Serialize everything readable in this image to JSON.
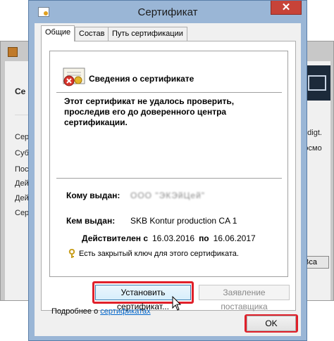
{
  "dialog": {
    "title": "Сертификат",
    "close_glyph": "✕",
    "tabs": [
      {
        "label": "Общие",
        "active": true
      },
      {
        "label": "Состав",
        "active": false
      },
      {
        "label": "Путь сертификации",
        "active": false
      }
    ]
  },
  "general": {
    "heading": "Сведения о сертификате",
    "warning": "Этот сертификат не удалось проверить, проследив его до доверенного центра сертификации.",
    "issued_to_label": "Кому выдан:",
    "issued_to_value": "ООО \"ЭКЭйЦей\"",
    "issued_by_label": "Кем выдан:",
    "issued_by_value": "SKB Kontur production CA 1",
    "valid_from_label": "Действителен с",
    "valid_from": "16.03.2016",
    "valid_to_label": "по",
    "valid_to": "16.06.2017",
    "private_key_note": "Есть закрытый ключ для этого сертификата."
  },
  "buttons": {
    "install": "Установить сертификат...",
    "issuer_statement": "Заявление поставщика",
    "ok": "OK"
  },
  "footer": {
    "prefix": "Подробнее о ",
    "link": "сертификатах"
  },
  "background_window": {
    "left_labels": [
      "Се",
      "Серт",
      "Субъ",
      "Пост",
      "Дейс",
      "Дейс",
      "Сери"
    ],
    "right_labels": [
      "@digt.",
      "Космо"
    ],
    "select_value": "Вса"
  },
  "colors": {
    "highlight": "#e0202a",
    "close_button": "#c74338",
    "title_bar": "#9ab6d6"
  },
  "icons": {
    "dialog": "certificate-icon",
    "info": "certificate-error-icon",
    "key": "key-icon",
    "cursor": "mouse-pointer-icon"
  }
}
